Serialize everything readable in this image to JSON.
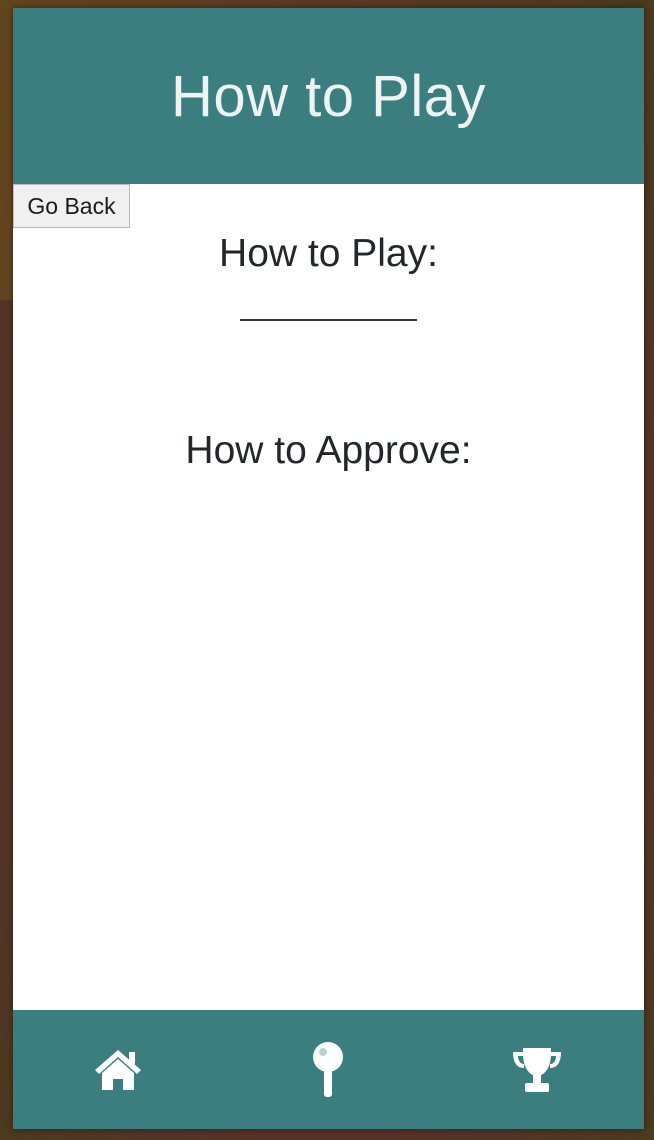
{
  "header": {
    "title": "How to Play"
  },
  "back_button": {
    "label": "Go Back"
  },
  "sections": [
    {
      "heading": "How to Play:"
    },
    {
      "heading": "How to Approve:"
    }
  ],
  "footer_nav": [
    {
      "icon": "home-icon"
    },
    {
      "icon": "map-pin-icon"
    },
    {
      "icon": "trophy-icon"
    }
  ],
  "colors": {
    "accent": "#3a7e7f",
    "header_text": "#eef3f3"
  }
}
